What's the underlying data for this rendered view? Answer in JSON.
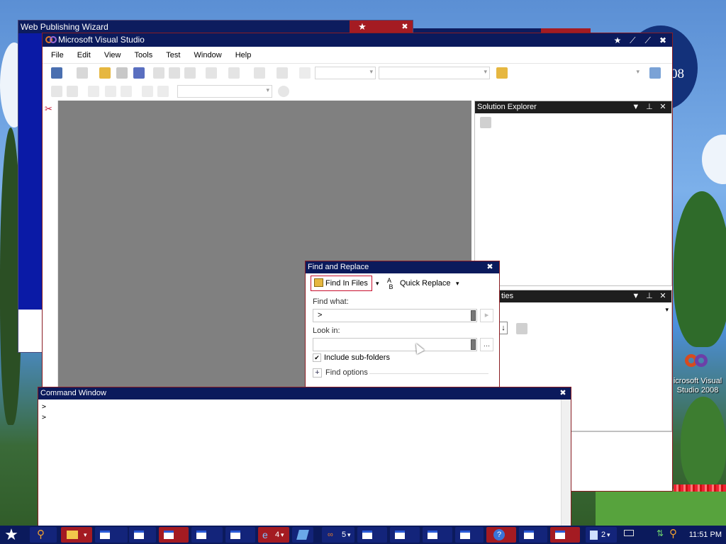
{
  "desktop": {
    "bg_window_title": "Web Publishing Wizard",
    "icon_label": "icrosoft Visual Studio 2008",
    "badge_text": "08"
  },
  "vs": {
    "title": "Microsoft Visual Studio",
    "menu": [
      "File",
      "Edit",
      "View",
      "Tools",
      "Test",
      "Window",
      "Help"
    ],
    "caption_buttons": [
      "star-icon",
      "minimize-icon",
      "restore-icon",
      "close-icon"
    ]
  },
  "solution_explorer": {
    "title": "Solution Explorer"
  },
  "properties": {
    "title": "ties"
  },
  "find_replace": {
    "title": "Find and Replace",
    "tab_find_in_files": "Find In Files",
    "tab_quick_replace": "Quick Replace",
    "find_what_label": "Find what:",
    "find_what_value": ">",
    "look_in_label": "Look in:",
    "look_in_value": "",
    "browse_label": "...",
    "include_subfolders_label": "Include sub-folders",
    "include_subfolders_checked": true,
    "find_options_label": "Find options"
  },
  "command_window": {
    "title": "Command Window",
    "lines": [
      ">",
      ">"
    ]
  },
  "taskbar": {
    "clock": "11:51 PM",
    "group_ie_count": "4",
    "group_vs_count": "5",
    "group_doc_count": "2"
  },
  "colors": {
    "titlebar": "#0b1a5c",
    "accent_red": "#a41b22",
    "editor_bg": "#808080"
  }
}
